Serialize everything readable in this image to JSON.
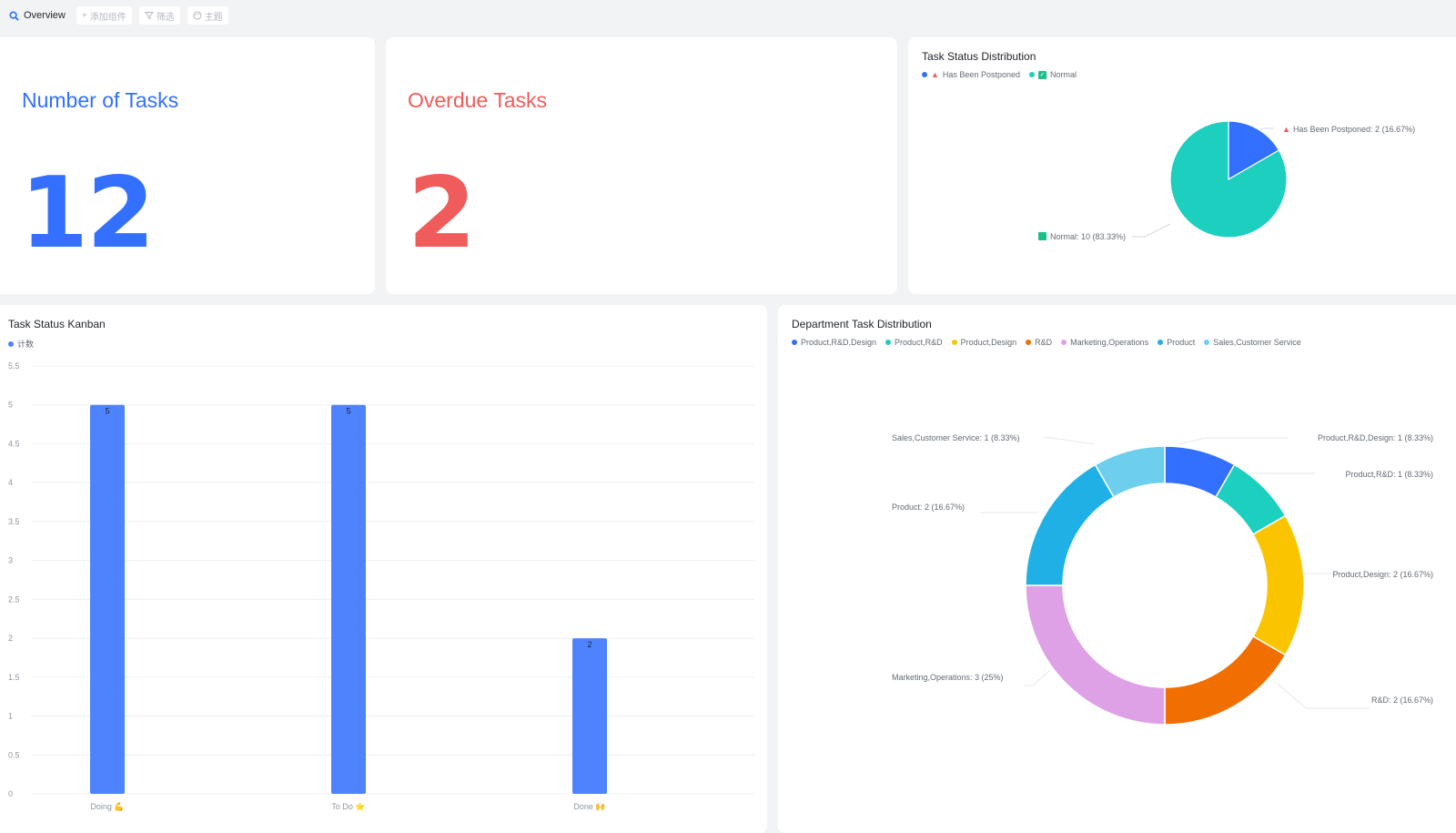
{
  "toolbar": {
    "overview_label": "Overview",
    "add_widget_label": "添加组件",
    "filter_label": "筛选",
    "theme_label": "主题"
  },
  "kpis": {
    "tasks": {
      "title": "Number of Tasks",
      "value": "12",
      "color": "#3370ff"
    },
    "overdue": {
      "title": "Overdue Tasks",
      "value": "2",
      "color": "#f05b5b"
    }
  },
  "status_pie": {
    "title": "Task Status Distribution",
    "legend": [
      {
        "label": "Has Been Postponed",
        "color": "#3370ff",
        "icon": "alert-icon"
      },
      {
        "label": "Normal",
        "color": "#1ccfbf",
        "icon": "check-icon"
      }
    ],
    "callouts": {
      "postponed": "Has Been Postponed: 2 (16.67%)",
      "normal": "Normal: 10 (83.33%)"
    }
  },
  "kanban": {
    "title": "Task Status Kanban",
    "legend_label": "计数",
    "categories": [
      "Doing 💪",
      "To Do ⭐",
      "Done 🙌"
    ]
  },
  "dept_donut": {
    "title": "Department Task Distribution",
    "legend": [
      {
        "label": "Product,R&D,Design",
        "color": "#3370ff"
      },
      {
        "label": "Product,R&D",
        "color": "#1ccfbf"
      },
      {
        "label": "Product,Design",
        "color": "#fac500"
      },
      {
        "label": "R&D",
        "color": "#f06f00"
      },
      {
        "label": "Marketing,Operations",
        "color": "#dfa1e6"
      },
      {
        "label": "Product",
        "color": "#1fb1e6"
      },
      {
        "label": "Sales,Customer Service",
        "color": "#6dcfed"
      }
    ],
    "callouts": [
      "Product,R&D,Design: 1 (8.33%)",
      "Product,R&D: 1 (8.33%)",
      "Product,Design: 2 (16.67%)",
      "R&D: 2 (16.67%)",
      "Marketing,Operations: 3 (25%)",
      "Product: 2 (16.67%)",
      "Sales,Customer Service: 1 (8.33%)"
    ]
  },
  "chart_data": [
    {
      "type": "pie",
      "title": "Task Status Distribution",
      "categories": [
        "Has Been Postponed",
        "Normal"
      ],
      "values": [
        2,
        10
      ],
      "colors": [
        "#3370ff",
        "#1ccfbf"
      ]
    },
    {
      "type": "bar",
      "title": "Task Status Kanban",
      "categories": [
        "Doing 💪",
        "To Do ⭐",
        "Done 🙌"
      ],
      "series": [
        {
          "name": "计数",
          "values": [
            5,
            5,
            2
          ]
        }
      ],
      "ylim": [
        0,
        5.5
      ],
      "yticks": [
        "0",
        "0.5",
        "1",
        "1.5",
        "2",
        "2.5",
        "3",
        "3.5",
        "4",
        "4.5",
        "5",
        "5.5"
      ],
      "grid": true,
      "legend": "top-left",
      "color": "#4e83fd"
    },
    {
      "type": "pie",
      "title": "Department Task Distribution",
      "categories": [
        "Product,R&D,Design",
        "Product,R&D",
        "Product,Design",
        "R&D",
        "Marketing,Operations",
        "Product",
        "Sales,Customer Service"
      ],
      "values": [
        1,
        1,
        2,
        2,
        3,
        2,
        1
      ],
      "colors": [
        "#3370ff",
        "#1ccfbf",
        "#fac500",
        "#f06f00",
        "#dfa1e6",
        "#1fb1e6",
        "#6dcfed"
      ],
      "donut": true,
      "legend": "top-left"
    }
  ]
}
